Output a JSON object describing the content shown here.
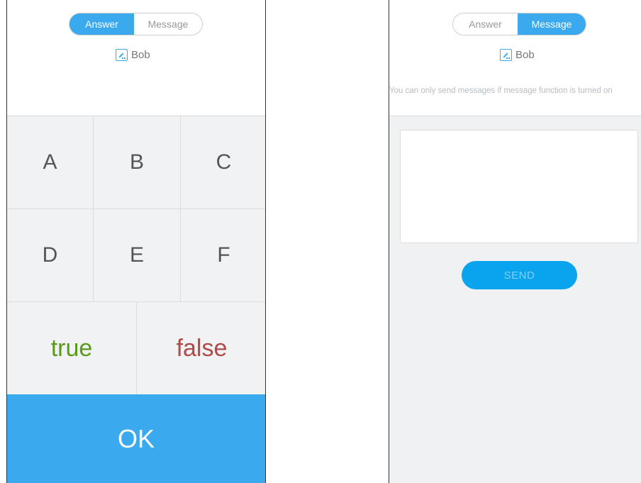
{
  "answer_screen": {
    "tabs": [
      {
        "label": "Answer",
        "active": true
      },
      {
        "label": "Message",
        "active": false
      }
    ],
    "user_name": "Bob",
    "options": [
      "A",
      "B",
      "C",
      "D",
      "E",
      "F"
    ],
    "true_label": "true",
    "false_label": "false",
    "ok_label": "OK"
  },
  "message_screen": {
    "tabs": [
      {
        "label": "Answer",
        "active": false
      },
      {
        "label": "Message",
        "active": true
      }
    ],
    "user_name": "Bob",
    "notice": "You can only send messages if message function is turned on",
    "message_value": "",
    "send_label": "SEND"
  },
  "colors": {
    "accent": "#3aa9ee",
    "true_color": "#5a9a1a",
    "false_color": "#b04a4a",
    "panel_bg": "#f1f2f3"
  }
}
